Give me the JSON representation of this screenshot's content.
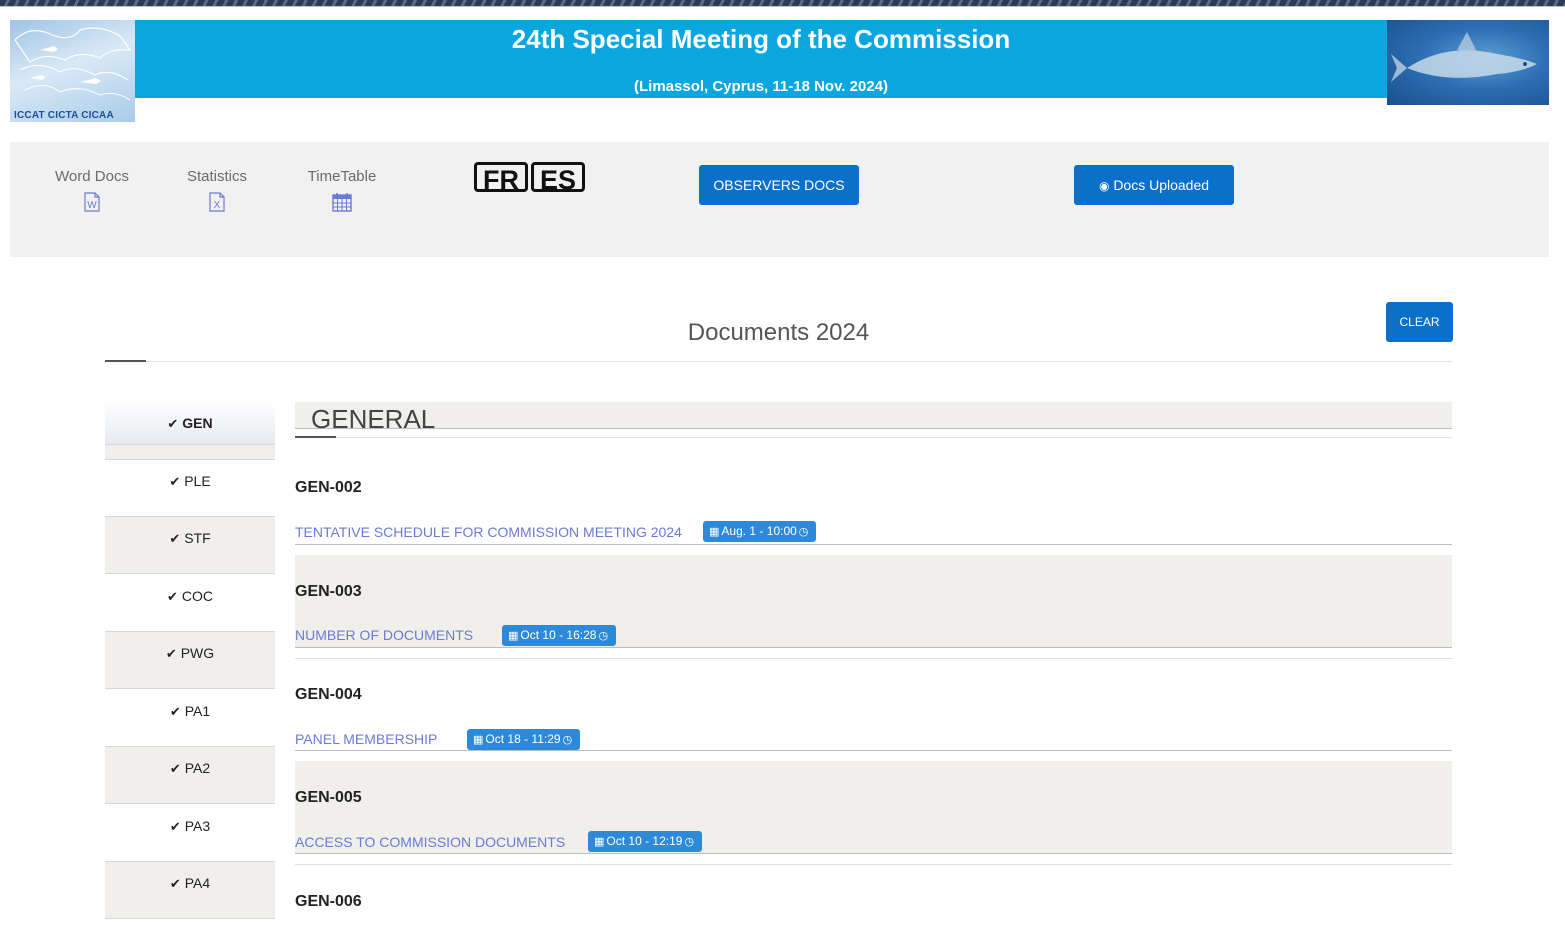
{
  "header": {
    "logo_text": "ICCAT  CICTA  CICAA",
    "title": "24th Special Meeting of the Commission",
    "subtitle": "(Limassol, Cyprus, 11-18 Nov. 2024)"
  },
  "toolbar": {
    "word_docs": "Word Docs",
    "statistics": "Statistics",
    "timetable": "TimeTable",
    "lang_fr": "FR",
    "lang_es": "ES",
    "observers_docs": "OBSERVERS DOCS",
    "docs_uploaded": "Docs Uploaded"
  },
  "documents": {
    "title": "Documents 2024",
    "clear": "CLEAR"
  },
  "tabs": [
    {
      "label": "GEN"
    },
    {
      "label": "PLE"
    },
    {
      "label": "STF"
    },
    {
      "label": "COC"
    },
    {
      "label": "PWG"
    },
    {
      "label": "PA1"
    },
    {
      "label": "PA2"
    },
    {
      "label": "PA3"
    },
    {
      "label": "PA4"
    }
  ],
  "section": {
    "title": "GENERAL",
    "items": [
      {
        "code": "GEN-002",
        "title": "TENTATIVE SCHEDULE FOR COMMISSION MEETING 2024",
        "date": "Aug. 1 - 10:00"
      },
      {
        "code": "GEN-003",
        "title": "NUMBER OF DOCUMENTS",
        "date": "Oct 10 - 16:28"
      },
      {
        "code": "GEN-004",
        "title": "PANEL MEMBERSHIP",
        "date": "Oct 18 - 11:29"
      },
      {
        "code": "GEN-005",
        "title": "ACCESS TO COMMISSION DOCUMENTS",
        "date": "Oct 10 - 12:19"
      },
      {
        "code": "GEN-006"
      }
    ]
  },
  "colors": {
    "banner": "#0aa6e0",
    "button": "#0a70c9",
    "badge": "#2e8ad8",
    "link": "#6a7bd6",
    "row_gray": "#f0efeb"
  }
}
